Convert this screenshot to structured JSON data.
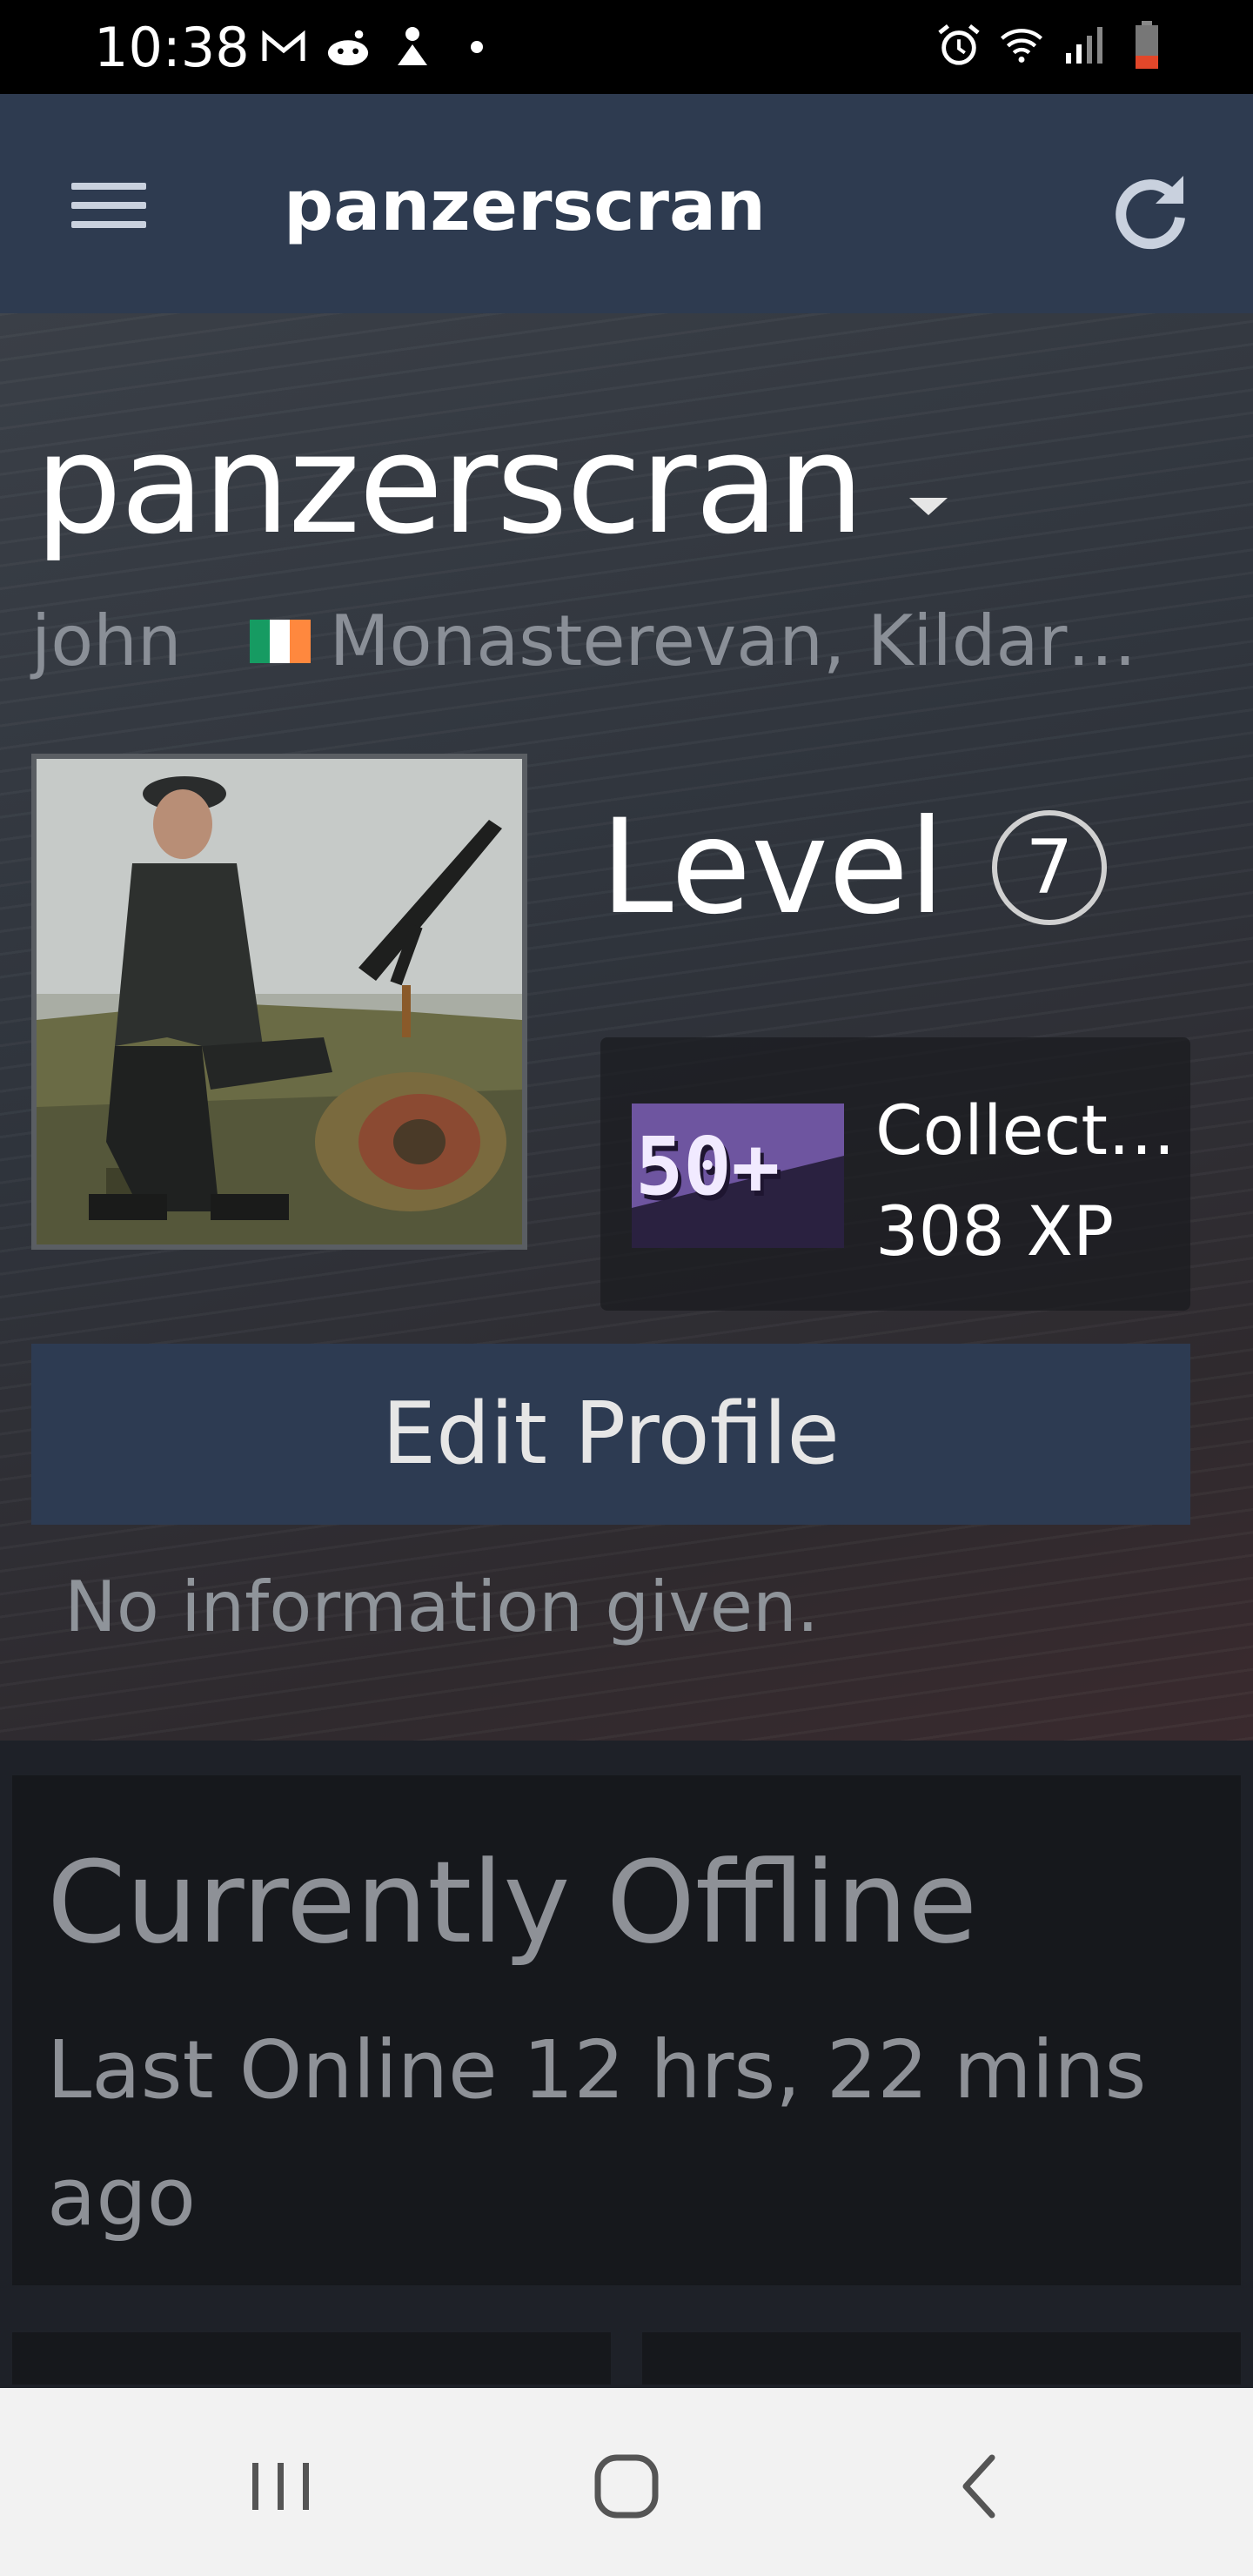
{
  "status_bar": {
    "time": "10:38",
    "left_icons": [
      "gmail-icon",
      "reddit-icon",
      "app-icon",
      "dot-icon"
    ],
    "right_icons": [
      "alarm-icon",
      "wifi-icon",
      "signal-icon",
      "battery-icon"
    ]
  },
  "app_bar": {
    "title": "panzerscran",
    "menu_icon": "hamburger-menu-icon",
    "refresh_icon": "refresh-icon"
  },
  "profile": {
    "persona_name": "panzerscran",
    "real_name": "john",
    "location": "Monasterevan, Kildar…",
    "flag_colors": [
      "#169b62",
      "#ffffff",
      "#ff883e"
    ],
    "level_label": "Level",
    "level": "7",
    "badge": {
      "icon_text": "50+",
      "name": "Collect…",
      "xp": "308 XP"
    },
    "edit_button": "Edit Profile",
    "summary": "No information given."
  },
  "status": {
    "title": "Currently Offline",
    "last_online": "Last Online 12 hrs, 22 mins ago"
  },
  "nav_bar": {
    "recents_icon": "recent-apps-icon",
    "home_icon": "home-icon",
    "back_icon": "back-icon"
  },
  "colors": {
    "app_bar": "#2e3b50",
    "button": "#2d3b52",
    "panel": "#16181c",
    "badge_purple": "#6e55a0"
  }
}
